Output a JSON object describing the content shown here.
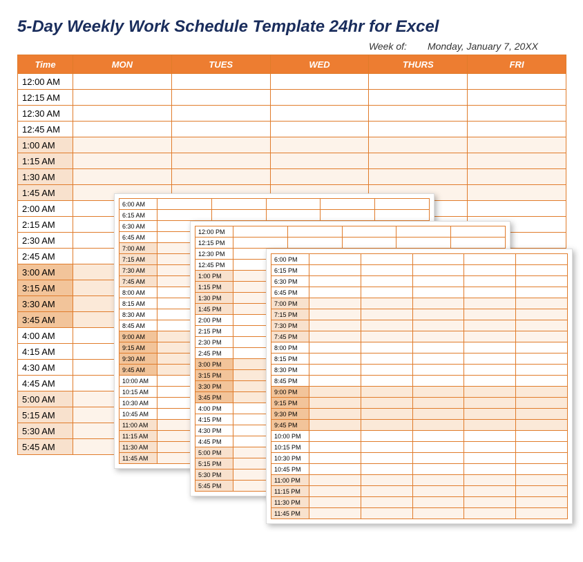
{
  "title": "5-Day Weekly Work Schedule Template 24hr for Excel",
  "week_label": "Week of:",
  "week_value": "Monday, January 7, 20XX",
  "columns": [
    "Time",
    "MON",
    "TUES",
    "WED",
    "THURS",
    "FRI"
  ],
  "main_times": [
    "12:00 AM",
    "12:15 AM",
    "12:30 AM",
    "12:45 AM",
    "1:00 AM",
    "1:15 AM",
    "1:30 AM",
    "1:45 AM",
    "2:00 AM",
    "2:15 AM",
    "2:30 AM",
    "2:45 AM",
    "3:00 AM",
    "3:15 AM",
    "3:30 AM",
    "3:45 AM",
    "4:00 AM",
    "4:15 AM",
    "4:30 AM",
    "4:45 AM",
    "5:00 AM",
    "5:15 AM",
    "5:30 AM",
    "5:45 AM"
  ],
  "page1_times": [
    "6:00 AM",
    "6:15 AM",
    "6:30 AM",
    "6:45 AM",
    "7:00 AM",
    "7:15 AM",
    "7:30 AM",
    "7:45 AM",
    "8:00 AM",
    "8:15 AM",
    "8:30 AM",
    "8:45 AM",
    "9:00 AM",
    "9:15 AM",
    "9:30 AM",
    "9:45 AM",
    "10:00 AM",
    "10:15 AM",
    "10:30 AM",
    "10:45 AM",
    "11:00 AM",
    "11:15 AM",
    "11:30 AM",
    "11:45 AM"
  ],
  "page2_times": [
    "12:00 PM",
    "12:15 PM",
    "12:30 PM",
    "12:45 PM",
    "1:00 PM",
    "1:15 PM",
    "1:30 PM",
    "1:45 PM",
    "2:00 PM",
    "2:15 PM",
    "2:30 PM",
    "2:45 PM",
    "3:00 PM",
    "3:15 PM",
    "3:30 PM",
    "3:45 PM",
    "4:00 PM",
    "4:15 PM",
    "4:30 PM",
    "4:45 PM",
    "5:00 PM",
    "5:15 PM",
    "5:30 PM",
    "5:45 PM"
  ],
  "page3_times": [
    "6:00 PM",
    "6:15 PM",
    "6:30 PM",
    "6:45 PM",
    "7:00 PM",
    "7:15 PM",
    "7:30 PM",
    "7:45 PM",
    "8:00 PM",
    "8:15 PM",
    "8:30 PM",
    "8:45 PM",
    "9:00 PM",
    "9:15 PM",
    "9:30 PM",
    "9:45 PM",
    "10:00 PM",
    "10:15 PM",
    "10:30 PM",
    "10:45 PM",
    "11:00 PM",
    "11:15 PM",
    "11:30 PM",
    "11:45 PM"
  ],
  "shade_pattern": [
    "light",
    "light",
    "light",
    "light",
    "mid",
    "mid",
    "mid",
    "mid",
    "light",
    "light",
    "light",
    "light",
    "dark",
    "dark",
    "dark",
    "dark",
    "light",
    "light",
    "light",
    "light",
    "mid",
    "mid",
    "mid",
    "mid"
  ]
}
